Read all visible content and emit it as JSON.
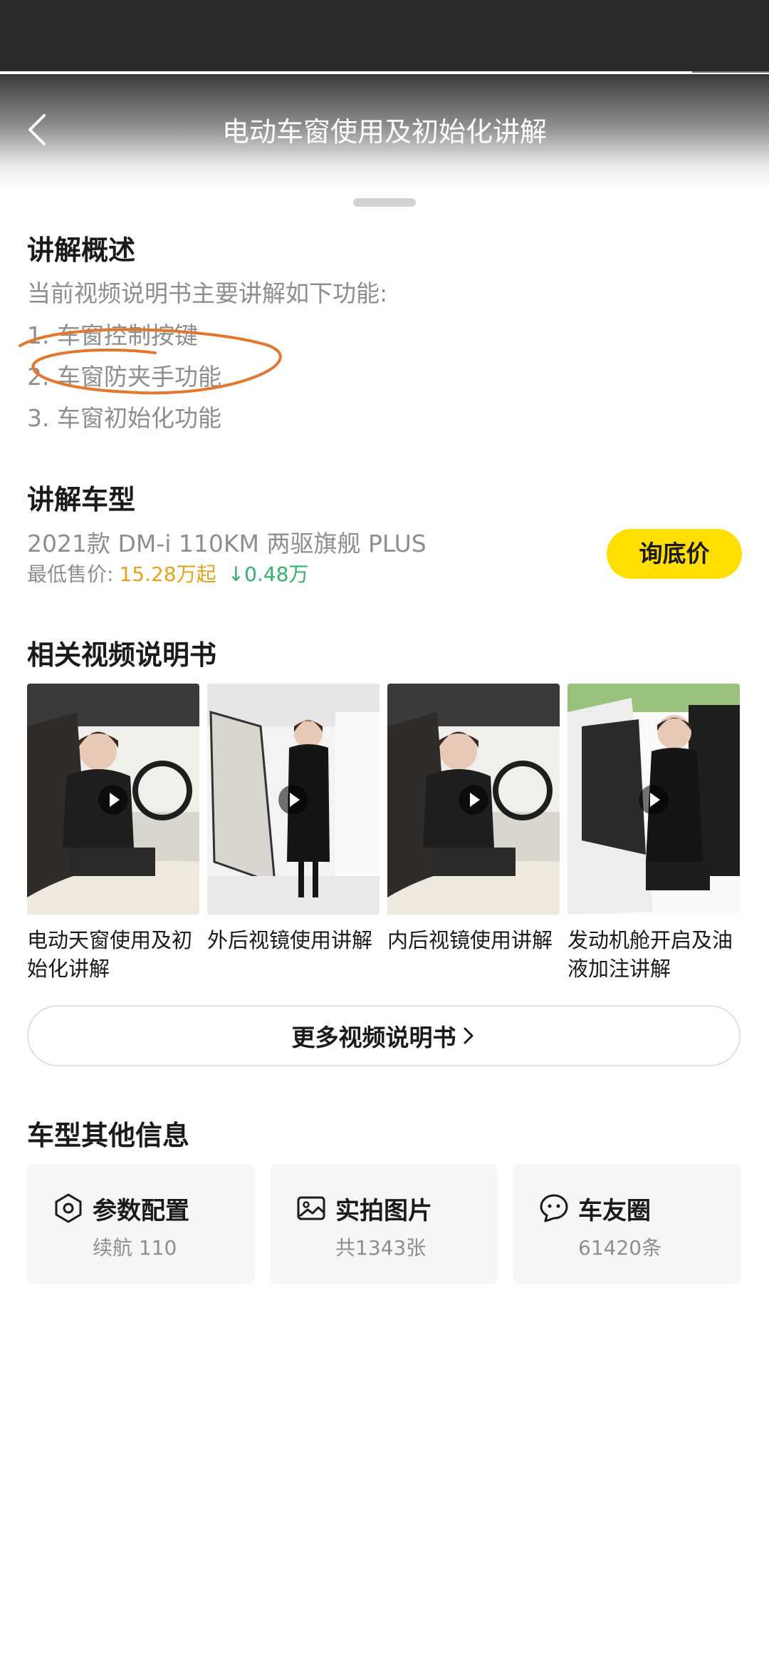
{
  "header": {
    "title": "电动车窗使用及初始化讲解",
    "progress": 0.9
  },
  "overview": {
    "heading": "讲解概述",
    "intro": "当前视频说明书主要讲解如下功能:",
    "items": [
      "1. 车窗控制按键",
      "2. 车窗防夹手功能",
      "3. 车窗初始化功能"
    ]
  },
  "model": {
    "heading": "讲解车型",
    "name": "2021款 DM-i 110KM 两驱旗舰 PLUS",
    "price_label": "最低售价:",
    "price": "15.28万起",
    "drop": "↓0.48万",
    "ask_label": "询底价"
  },
  "related": {
    "heading": "相关视频说明书",
    "videos": [
      {
        "title": "电动天窗使用及初始化讲解"
      },
      {
        "title": "外后视镜使用讲解"
      },
      {
        "title": "内后视镜使用讲解"
      },
      {
        "title": "发动机舱开启及油液加注讲解"
      }
    ],
    "more_label": "更多视频说明书"
  },
  "other": {
    "heading": "车型其他信息",
    "cards": [
      {
        "title": "参数配置",
        "sub": "续航 110",
        "icon": "settings-hex-icon"
      },
      {
        "title": "实拍图片",
        "sub": "共1343张",
        "icon": "image-icon"
      },
      {
        "title": "车友圈",
        "sub": "61420条",
        "icon": "chat-bubble-icon"
      }
    ]
  },
  "colors": {
    "accent_yellow": "#ffdf00",
    "price_orange": "#e7a21a",
    "drop_green": "#33b26b"
  }
}
